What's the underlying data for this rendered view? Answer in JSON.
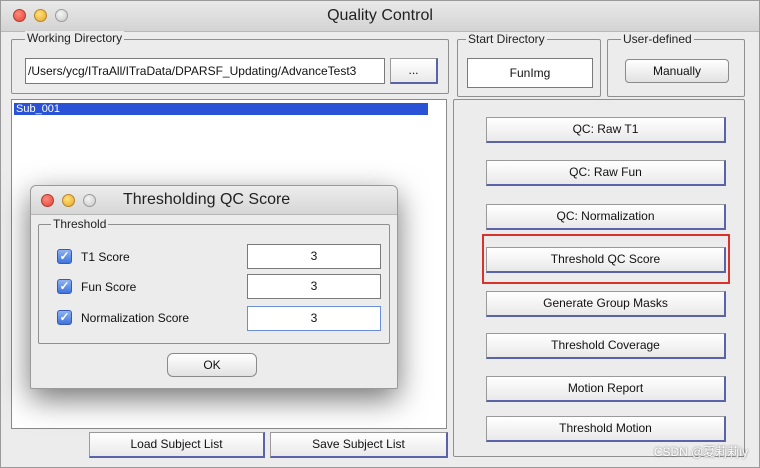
{
  "window": {
    "title": "Quality Control"
  },
  "working_directory": {
    "label": "Working Directory",
    "path": "/Users/ycg/ITraAll/ITraData/DPARSF_Updating/AdvanceTest3",
    "browse_label": "..."
  },
  "start_directory": {
    "label": "Start Directory",
    "value": "FunImg"
  },
  "user_defined": {
    "label": "User-defined",
    "button_label": "Manually"
  },
  "subject_list": {
    "items": [
      "Sub_001"
    ],
    "selected": "Sub_001"
  },
  "bottom_buttons": {
    "load": "Load Subject List",
    "save": "Save Subject List"
  },
  "right_buttons": [
    "QC: Raw T1",
    "QC: Raw Fun",
    "QC: Normalization",
    "Threshold QC Score",
    "Generate Group Masks",
    "Threshold Coverage",
    "Motion Report",
    "Threshold Motion"
  ],
  "highlight_color": "#d9322a",
  "dialog": {
    "title": "Thresholding QC Score",
    "group_label": "Threshold",
    "rows": [
      {
        "label": "T1 Score",
        "checked": true,
        "value": "3"
      },
      {
        "label": "Fun Score",
        "checked": true,
        "value": "3"
      },
      {
        "label": "Normalization Score",
        "checked": true,
        "value": "3"
      }
    ],
    "ok_label": "OK"
  },
  "watermark": "CSDN @夏莉莉iy"
}
